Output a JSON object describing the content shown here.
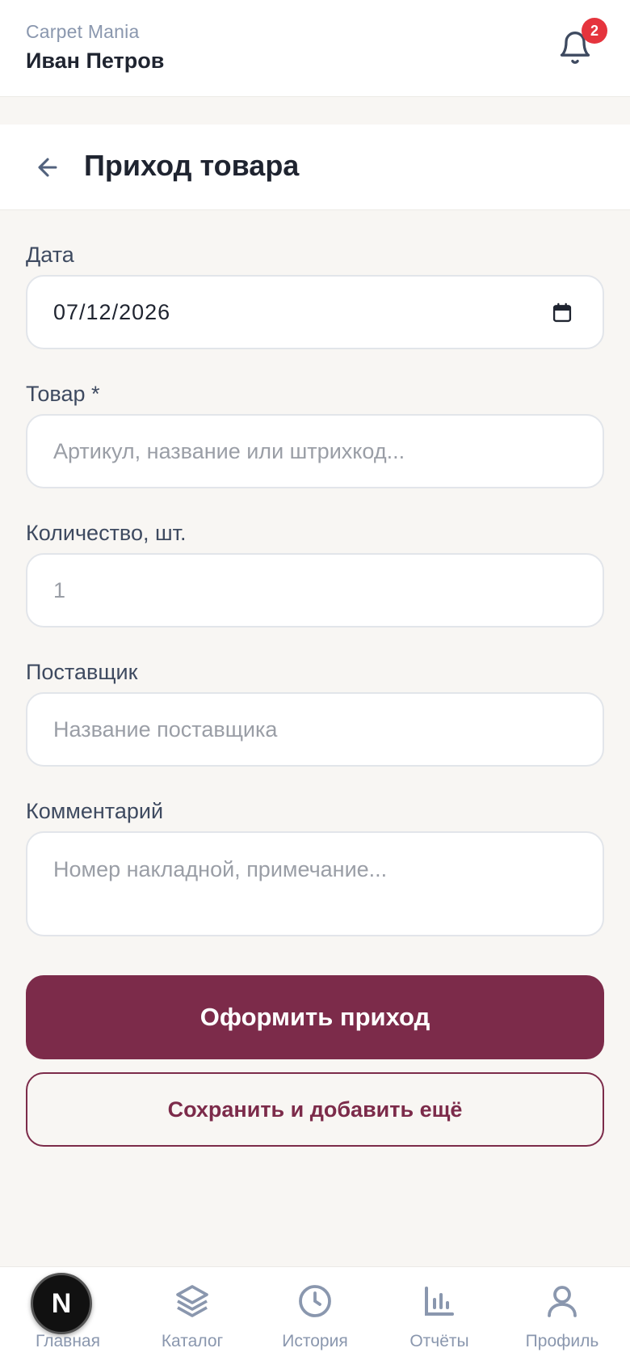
{
  "header": {
    "brand": "Carpet Mania",
    "user_name": "Иван Петров",
    "notifications_count": "2"
  },
  "page": {
    "title": "Приход товара"
  },
  "form": {
    "date": {
      "label": "Дата",
      "value": "07/12/2026"
    },
    "product": {
      "label": "Товар *",
      "placeholder": "Артикул, название или штрихкод..."
    },
    "quantity": {
      "label": "Количество, шт.",
      "placeholder": "1"
    },
    "supplier": {
      "label": "Поставщик",
      "placeholder": "Название поставщика"
    },
    "comment": {
      "label": "Комментарий",
      "placeholder": "Номер накладной, примечание..."
    },
    "submit_label": "Оформить приход",
    "save_more_label": "Сохранить и добавить ещё"
  },
  "bottom_nav": {
    "items": [
      {
        "label": "Главная",
        "icon": "home-icon"
      },
      {
        "label": "Каталог",
        "icon": "layers-icon"
      },
      {
        "label": "История",
        "icon": "clock-icon"
      },
      {
        "label": "Отчёты",
        "icon": "bar-chart-icon"
      },
      {
        "label": "Профиль",
        "icon": "user-icon"
      }
    ]
  },
  "dev_badge": {
    "letter": "N"
  },
  "colors": {
    "accent": "#7c2b4a",
    "background": "#f8f6f3",
    "badge": "#e5343d",
    "muted": "#8a97ae"
  }
}
